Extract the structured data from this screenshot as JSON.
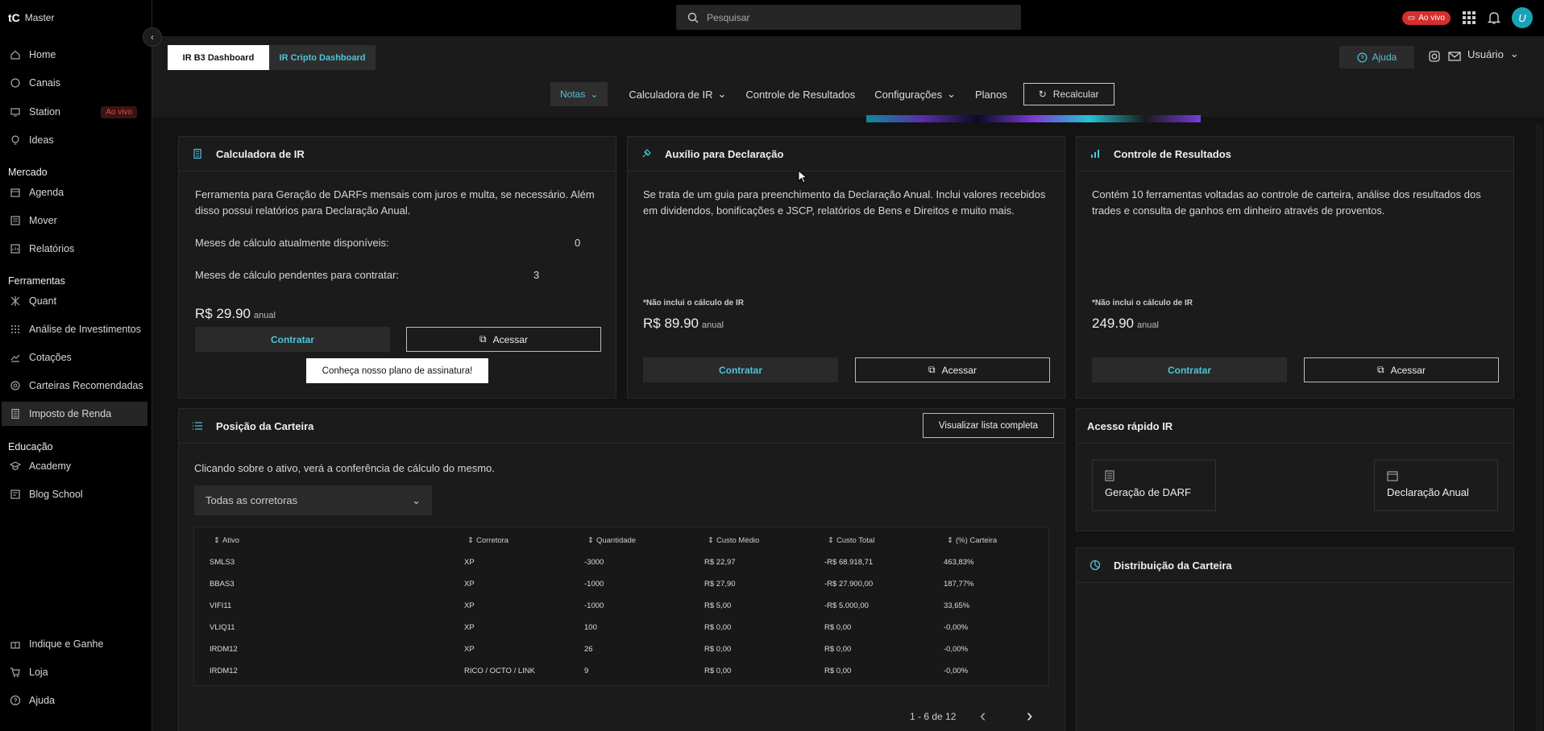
{
  "sidebar": {
    "brand": "Master",
    "logo": "tC",
    "items": [
      {
        "label": "Home",
        "icon": "home-icon"
      },
      {
        "label": "Canais",
        "icon": "chat-icon"
      },
      {
        "label": "Station",
        "icon": "monitor-icon",
        "badge": "Ao vivo"
      },
      {
        "label": "Ideas",
        "icon": "lightbulb-icon"
      }
    ],
    "section_mercado": "Mercado",
    "mercado": [
      {
        "label": "Agenda",
        "icon": "calendar-icon"
      },
      {
        "label": "Mover",
        "icon": "list-icon"
      },
      {
        "label": "Relatórios",
        "icon": "report-icon"
      }
    ],
    "section_ferramentas": "Ferramentas",
    "ferramentas": [
      {
        "label": "Quant",
        "icon": "quant-icon"
      },
      {
        "label": "Análise de Investimentos",
        "icon": "grid-icon"
      },
      {
        "label": "Cotações",
        "icon": "chart-icon"
      },
      {
        "label": "Carteiras Recomendadas",
        "icon": "target-icon"
      },
      {
        "label": "Imposto de Renda",
        "icon": "calculator-icon"
      }
    ],
    "section_educacao": "Educação",
    "educacao": [
      {
        "label": "Academy",
        "icon": "graduation-icon"
      },
      {
        "label": "Blog School",
        "icon": "blog-icon"
      }
    ],
    "bottom": [
      {
        "label": "Indique e Ganhe",
        "icon": "gift-icon"
      },
      {
        "label": "Loja",
        "icon": "cart-icon"
      },
      {
        "label": "Ajuda",
        "icon": "help-icon"
      }
    ]
  },
  "topbar": {
    "search_placeholder": "Pesquisar",
    "live": "Ao vivo",
    "avatar": "U"
  },
  "header": {
    "tab_b3": "IR B3 Dashboard",
    "tab_cripto": "IR Cripto Dashboard",
    "help": "Ajuda",
    "user": "Usuário"
  },
  "menu": {
    "notas": "Notas",
    "calculadora": "Calculadora de IR",
    "controle": "Controle de Resultados",
    "config": "Configurações",
    "planos": "Planos",
    "recalcular": "Recalcular"
  },
  "card_calc": {
    "title": "Calculadora de IR",
    "desc": "Ferramenta para Geração de DARFs mensais com juros e multa, se necessário. Além disso possui relatórios para Declaração Anual.",
    "label_disp": "Meses de cálculo atualmente disponíveis:",
    "val_disp": "0",
    "label_pend": "Meses de cálculo pendentes para contratar:",
    "val_pend": "3",
    "price": "R$ 29.90",
    "period": "anual",
    "contratar": "Contratar",
    "acessar": "Acessar",
    "promo": "Conheça nosso plano de assinatura!"
  },
  "card_aux": {
    "title": "Auxílio para Declaração",
    "desc": "Se trata de um guia para preenchimento da Declaração Anual. Inclui valores recebidos em dividendos, bonificações e JSCP, relatórios de Bens e Direitos e muito mais.",
    "note": "*Não inclui o cálculo de IR",
    "price": "R$ 89.90",
    "period": "anual",
    "contratar": "Contratar",
    "acessar": "Acessar"
  },
  "card_ctrl": {
    "title": "Controle de Resultados",
    "desc": "Contém 10 ferramentas voltadas ao controle de carteira, análise dos resultados dos trades e consulta de ganhos em dinheiro através de proventos.",
    "note": "*Não inclui o cálculo de IR",
    "price": "249.90",
    "period": "anual",
    "contratar": "Contratar",
    "acessar": "Acessar"
  },
  "posicao": {
    "title": "Posição da Carteira",
    "view_all": "Visualizar lista completa",
    "hint": "Clicando sobre o ativo, verá a conferência de cálculo do mesmo.",
    "select": "Todas as corretoras",
    "headers": [
      "Ativo",
      "Corretora",
      "Quantidade",
      "Custo Médio",
      "Custo Total",
      "(%) Carteira"
    ],
    "rows": [
      [
        "SMLS3",
        "XP",
        "-3000",
        "R$ 22,97",
        "-R$ 68.918,71",
        "463,83%"
      ],
      [
        "BBAS3",
        "XP",
        "-1000",
        "R$ 27,90",
        "-R$ 27.900,00",
        "187,77%"
      ],
      [
        "VIFI11",
        "XP",
        "-1000",
        "R$ 5,00",
        "-R$ 5.000,00",
        "33,65%"
      ],
      [
        "VLIQ11",
        "XP",
        "100",
        "R$ 0,00",
        "R$ 0,00",
        "-0,00%"
      ],
      [
        "IRDM12",
        "XP",
        "26",
        "R$ 0,00",
        "R$ 0,00",
        "-0,00%"
      ],
      [
        "IRDM12",
        "RICO / OCTO / LINK",
        "9",
        "R$ 0,00",
        "R$ 0,00",
        "-0,00%"
      ]
    ],
    "pagination": "1 - 6 de 12"
  },
  "acesso": {
    "title": "Acesso rápido IR",
    "darf": "Geração de DARF",
    "anual": "Declaração Anual"
  },
  "distribuicao": {
    "title": "Distribuição da Carteira"
  },
  "colors": {
    "accent": "#4fc3d9",
    "live": "#d32f2f"
  }
}
